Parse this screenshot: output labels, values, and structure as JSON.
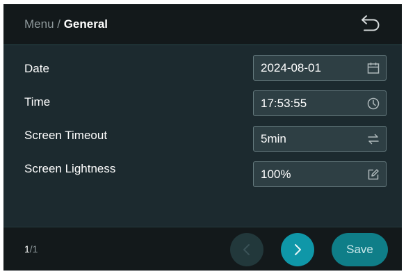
{
  "header": {
    "breadcrumb_parent": "Menu",
    "breadcrumb_separator": " / ",
    "breadcrumb_current": "General",
    "back_icon": "undo-arrow-icon"
  },
  "settings": [
    {
      "label": "Date",
      "value": "2024-08-01",
      "icon": "calendar-icon"
    },
    {
      "label": "Time",
      "value": "17:53:55",
      "icon": "clock-icon"
    },
    {
      "label": "Screen Timeout",
      "value": "5min",
      "icon": "swap-arrows-icon"
    },
    {
      "label": "Screen Lightness",
      "value": "100%",
      "icon": "edit-icon"
    }
  ],
  "footer": {
    "page_current": "1",
    "page_total": "/1",
    "prev_icon": "chevron-left-icon",
    "next_icon": "chevron-right-icon",
    "save_label": "Save"
  },
  "colors": {
    "background": "#1c2a2f",
    "bar": "#13191b",
    "field_background": "#2e3f44",
    "field_border": "#64797d",
    "accent": "#0f97a8",
    "save_button": "#0f7e88",
    "disabled_button": "#22383b"
  }
}
